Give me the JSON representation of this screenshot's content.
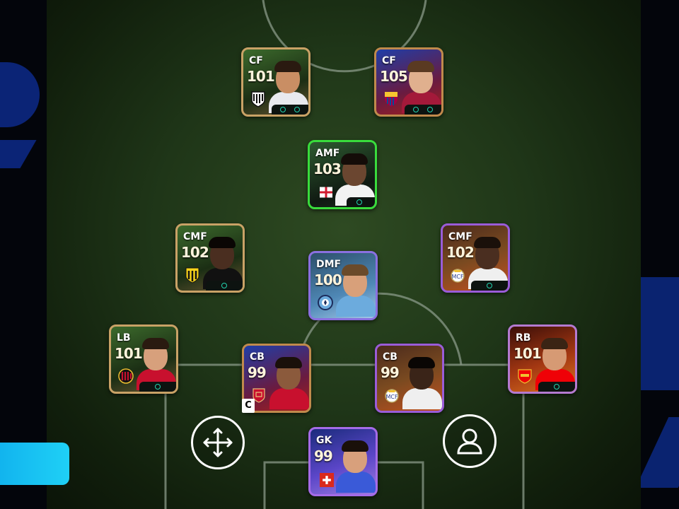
{
  "players": [
    {
      "id": "cf-left",
      "position": "CF",
      "rating": "101",
      "style": "gold",
      "badge": "santos-crest-icon",
      "tags": 2
    },
    {
      "id": "cf-right",
      "position": "CF",
      "rating": "105",
      "style": "blue",
      "badge": "barcelona-crest-icon",
      "tags": 2
    },
    {
      "id": "amf",
      "position": "AMF",
      "rating": "103",
      "style": "green",
      "badge": "england-flag-icon",
      "tags": 1
    },
    {
      "id": "cmf-left",
      "position": "CMF",
      "rating": "102",
      "style": "gold",
      "badge": "penarol-crest-icon",
      "tags": 1
    },
    {
      "id": "cmf-right",
      "position": "CMF",
      "rating": "102",
      "style": "purple",
      "badge": "real-madrid-crest-icon",
      "tags": 1
    },
    {
      "id": "dmf",
      "position": "DMF",
      "rating": "100",
      "style": "teal",
      "badge": "manchester-city-crest-icon",
      "tags": 1
    },
    {
      "id": "lb",
      "position": "LB",
      "rating": "101",
      "style": "gold",
      "badge": "ac-milan-crest-icon",
      "tags": 1
    },
    {
      "id": "cb-left",
      "position": "CB",
      "rating": "99",
      "style": "blue",
      "badge": "liverpool-crest-icon",
      "tags": 0
    },
    {
      "id": "cb-right",
      "position": "CB",
      "rating": "99",
      "style": "purple",
      "badge": "real-madrid-crest-icon",
      "tags": 0
    },
    {
      "id": "rb",
      "position": "RB",
      "rating": "101",
      "style": "fire",
      "badge": "arsenal-crest-icon",
      "tags": 1
    },
    {
      "id": "gk",
      "position": "GK",
      "rating": "99",
      "style": "gk",
      "badge": "switzerland-flag-icon",
      "tags": 0
    }
  ],
  "captain_label": "C",
  "controls": {
    "move_icon": "move-arrows-icon",
    "profile_icon": "user-profile-icon"
  },
  "colors": {
    "pitch_green": "#1f3618",
    "accent_cyan": "#1fc6f2",
    "highlight_green": "#39dc3c"
  }
}
